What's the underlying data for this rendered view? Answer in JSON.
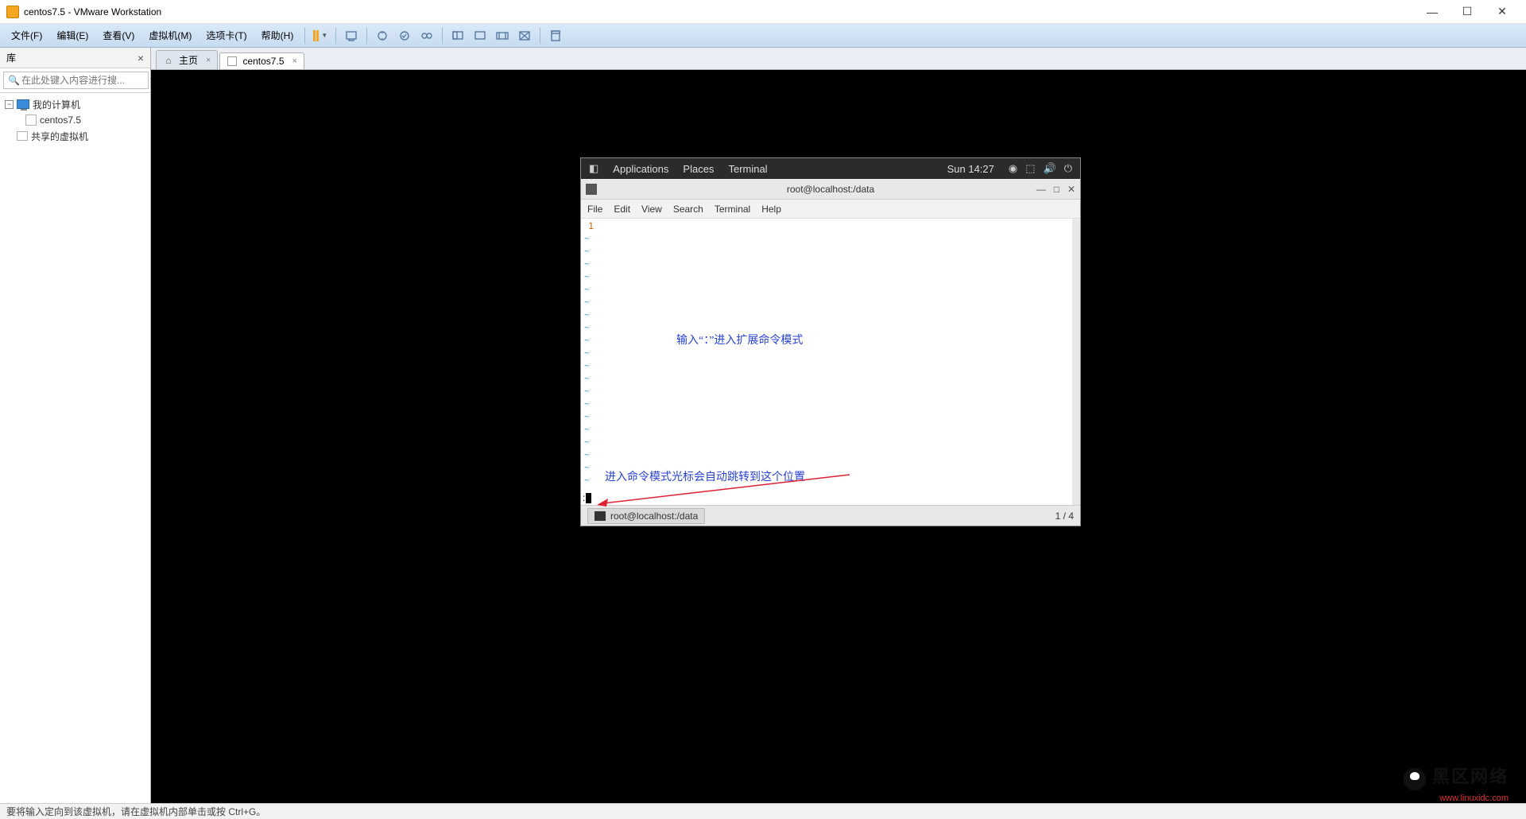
{
  "window": {
    "title": "centos7.5 - VMware Workstation"
  },
  "menubar": {
    "file": "文件(F)",
    "edit": "编辑(E)",
    "view": "查看(V)",
    "vm": "虚拟机(M)",
    "tabs": "选项卡(T)",
    "help": "帮助(H)"
  },
  "sidebar": {
    "title": "库",
    "search_placeholder": "在此处键入内容进行搜...",
    "nodes": {
      "root": "我的计算机",
      "vm": "centos7.5",
      "shared": "共享的虚拟机"
    }
  },
  "tabs": {
    "home": "主页",
    "vm": "centos7.5"
  },
  "gnome": {
    "applications": "Applications",
    "places": "Places",
    "terminal_app": "Terminal",
    "clock": "Sun 14:27",
    "term_title": "root@localhost:/data",
    "term_menu": {
      "file": "File",
      "edit": "Edit",
      "view": "View",
      "search": "Search",
      "terminal": "Terminal",
      "help": "Help"
    },
    "line_number": "1",
    "cmd_prefix": ":",
    "taskbar_app": "root@localhost:/data",
    "workspace_indicator": "1 / 4"
  },
  "annotations": {
    "a1": "输入“：”进入扩展命令模式",
    "a2": "进入命令模式光标会自动跳转到这个位置"
  },
  "statusbar": {
    "text": "要将输入定向到该虚拟机，请在虚拟机内部单击或按 Ctrl+G。"
  },
  "watermark": {
    "zh": "黑区网络",
    "en": "www.linuxidc.com"
  }
}
